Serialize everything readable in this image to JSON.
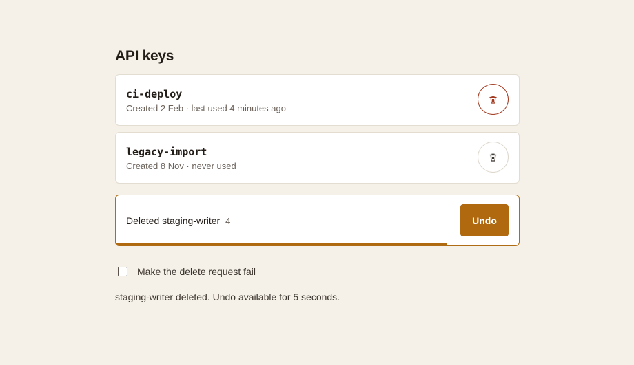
{
  "page": {
    "title": "API keys"
  },
  "keys": [
    {
      "name": "ci-deploy",
      "meta": "Created 2 Feb · last used 4 minutes ago",
      "delete_icon": "trash-icon",
      "state": "danger-focus"
    },
    {
      "name": "legacy-import",
      "meta": "Created 8 Nov · never used",
      "delete_icon": "trash-icon",
      "state": "default"
    }
  ],
  "toast": {
    "message": "Deleted staging-writer",
    "countdown": "4",
    "undo_label": "Undo",
    "progress_fraction": 0.82
  },
  "fail_toggle": {
    "label": "Make the delete request fail",
    "checked": false
  },
  "status_text": "staging-writer deleted. Undo available for 5 seconds.",
  "colors": {
    "background": "#f5f0e8",
    "accent": "#b0690f",
    "danger": "#a13a20",
    "card_border": "#e3dcd1"
  }
}
